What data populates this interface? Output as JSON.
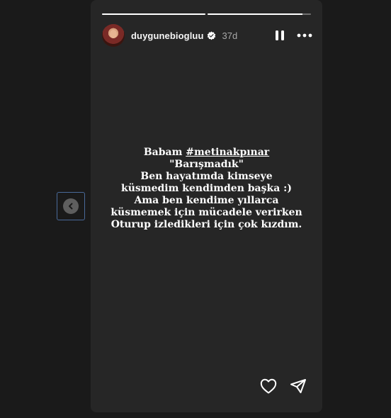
{
  "story": {
    "progress": [
      1.0,
      0.92
    ],
    "user": {
      "username": "duygunebiogluu",
      "verified": true,
      "time": "37d"
    },
    "text_lines": [
      {
        "prefix": "Babam ",
        "hashtag": "#metinakpınar"
      },
      {
        "text": "\"Barışmadık\""
      },
      {
        "text": "Ben hayatımda kimseye"
      },
      {
        "text": "küsmedim kendimden başka :)"
      },
      {
        "text": "Ama ben kendime yıllarca"
      },
      {
        "text": "küsmemek için mücadele verirken"
      },
      {
        "text": "Oturup izledikleri için çok kızdım."
      }
    ]
  },
  "icons": {
    "pause": "pause-icon",
    "more": "more-icon",
    "prev": "chevron-left-icon",
    "like": "heart-icon",
    "share": "paper-plane-icon",
    "verified": "verified-badge-icon"
  },
  "colors": {
    "story_bg": "#262626",
    "page_bg": "#1a1a1a",
    "verified": "#0095f6",
    "text": "#ffffff",
    "muted": "#a8a8a8"
  }
}
